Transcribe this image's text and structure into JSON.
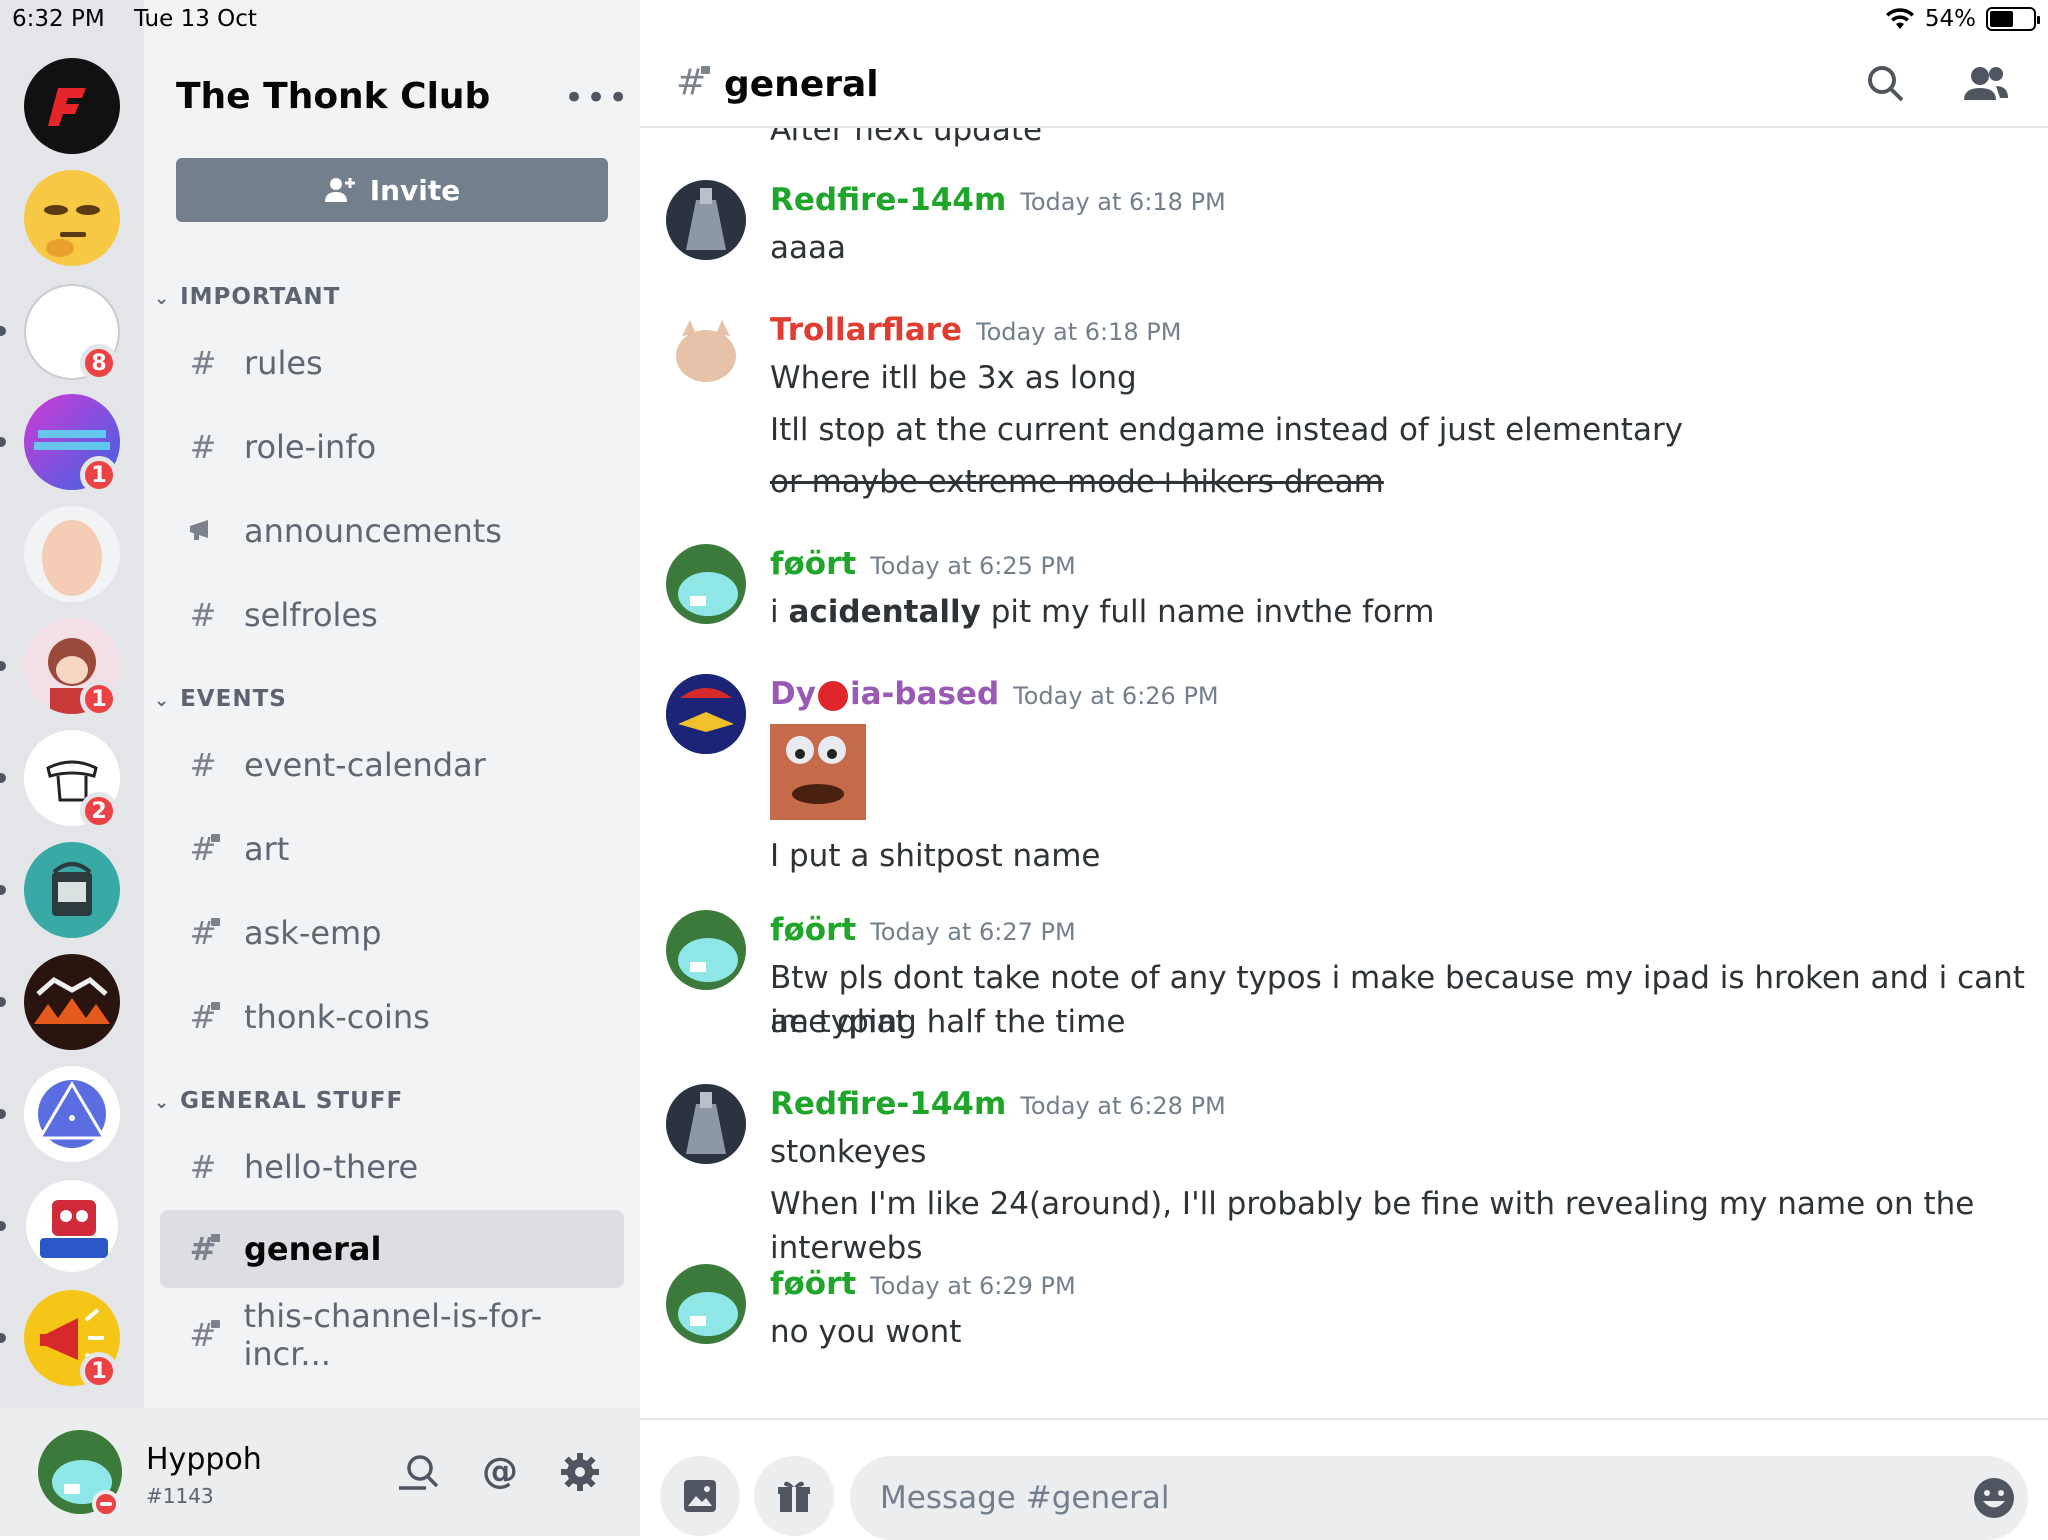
{
  "status_bar": {
    "time": "6:32 PM",
    "date": "Tue 13 Oct",
    "battery": "54%"
  },
  "servers": [
    {
      "name": "server-f",
      "badge": ""
    },
    {
      "name": "server-thinking",
      "badge": ""
    },
    {
      "name": "server-white",
      "badge": "8"
    },
    {
      "name": "server-angel",
      "badge": "1"
    },
    {
      "name": "server-egg",
      "badge": ""
    },
    {
      "name": "server-anime",
      "badge": "1"
    },
    {
      "name": "server-doodle",
      "badge": "2"
    },
    {
      "name": "server-bucket",
      "badge": ""
    },
    {
      "name": "server-woc",
      "badge": ""
    },
    {
      "name": "server-tcd",
      "badge": ""
    },
    {
      "name": "server-cookies",
      "badge": ""
    },
    {
      "name": "server-megaphone",
      "badge": "1"
    }
  ],
  "guild": {
    "name": "The Thonk Club",
    "invite_label": "Invite"
  },
  "categories": [
    {
      "name": "IMPORTANT"
    },
    {
      "name": "EVENTS"
    },
    {
      "name": "GENERAL STUFF"
    }
  ],
  "channels": [
    {
      "name": "rules",
      "icon": "hash"
    },
    {
      "name": "role-info",
      "icon": "hash"
    },
    {
      "name": "announcements",
      "icon": "megaphone"
    },
    {
      "name": "selfroles",
      "icon": "hash"
    },
    {
      "name": "event-calendar",
      "icon": "hash"
    },
    {
      "name": "art",
      "icon": "locked-hash"
    },
    {
      "name": "ask-emp",
      "icon": "locked-hash"
    },
    {
      "name": "thonk-coins",
      "icon": "locked-hash"
    },
    {
      "name": "hello-there",
      "icon": "hash"
    },
    {
      "name": "general",
      "icon": "locked-hash",
      "active": true
    },
    {
      "name": "this-channel-is-for-incr...",
      "icon": "locked-hash"
    }
  ],
  "user": {
    "name": "Hyppoh",
    "tag": "#1143",
    "status": "dnd"
  },
  "header": {
    "channel": "general"
  },
  "cut_message": "After next update",
  "messages": [
    {
      "author": "Redfire-144m",
      "color": "#1fa62a",
      "time": "Today at 6:18 PM",
      "lines": [
        "aaaa"
      ]
    },
    {
      "author": "Trollarflare",
      "color": "#e03c31",
      "time": "Today at 6:18 PM",
      "lines": [
        "Where itll be 3x as long",
        "Itll stop at the current endgame instead of just elementary",
        "or maybe extreme mode+hikers dream"
      ]
    },
    {
      "author": "føört",
      "color": "#1fa62a",
      "time": "Today at 6:25 PM",
      "lines_pre": "i ",
      "lines_bold": "acidentally",
      "lines_post": " pit my full name invthe form"
    },
    {
      "author_a": "Dy",
      "author_b": "ia-based",
      "color": "#9b59b6",
      "time": "Today at 6:26 PM",
      "lines": [
        "I put a shitpost name"
      ]
    },
    {
      "author": "føört",
      "color": "#1fa62a",
      "time": "Today at 6:27 PM",
      "lines": [
        "Btw pls dont take note of any typos i make because my ipad is hroken and i cant aee qhat",
        "im typing half the time"
      ]
    },
    {
      "author": "Redfire-144m",
      "color": "#1fa62a",
      "time": "Today at 6:28 PM",
      "lines": [
        "stonkeyes",
        "When I'm like 24(around), I'll probably be fine with revealing my name on the interwebs"
      ]
    },
    {
      "author": "føört",
      "color": "#1fa62a",
      "time": "Today at 6:29 PM",
      "lines": [
        "no you wont"
      ]
    }
  ],
  "composer": {
    "placeholder": "Message #general"
  }
}
